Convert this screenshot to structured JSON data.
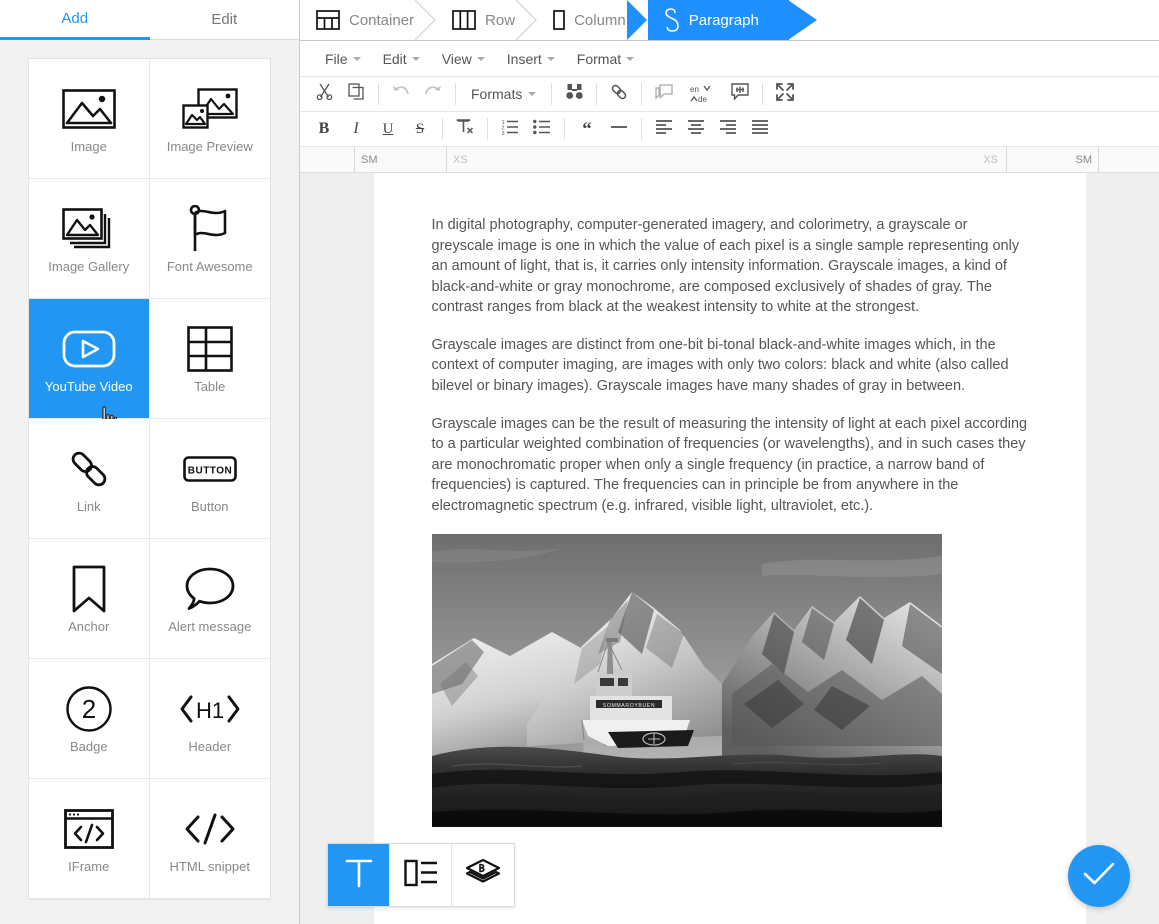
{
  "sidebar": {
    "tabs": [
      {
        "label": "Add",
        "active": true
      },
      {
        "label": "Edit",
        "active": false
      }
    ],
    "items": [
      {
        "label": "Image",
        "icon": "image-icon",
        "active": false
      },
      {
        "label": "Image Preview",
        "icon": "image-preview-icon",
        "active": false
      },
      {
        "label": "Image Gallery",
        "icon": "image-gallery-icon",
        "active": false
      },
      {
        "label": "Font Awesome",
        "icon": "flag-icon",
        "active": false
      },
      {
        "label": "YouTube Video",
        "icon": "youtube-play-icon",
        "active": true
      },
      {
        "label": "Table",
        "icon": "table-icon",
        "active": false
      },
      {
        "label": "Link",
        "icon": "chain-link-icon",
        "active": false
      },
      {
        "label": "Button",
        "icon": "button-icon",
        "active": false
      },
      {
        "label": "Anchor",
        "icon": "bookmark-icon",
        "active": false
      },
      {
        "label": "Alert message",
        "icon": "speech-bubble-icon",
        "active": false
      },
      {
        "label": "Badge",
        "icon": "badge-circle-icon",
        "active": false
      },
      {
        "label": "Header",
        "icon": "h1-tag-icon",
        "active": false
      },
      {
        "label": "IFrame",
        "icon": "iframe-window-icon",
        "active": false
      },
      {
        "label": "HTML snippet",
        "icon": "code-tag-icon",
        "active": false
      }
    ]
  },
  "breadcrumb": [
    {
      "label": "Container",
      "icon": "container-grid-icon",
      "active": false
    },
    {
      "label": "Row",
      "icon": "row-columns-icon",
      "active": false
    },
    {
      "label": "Column",
      "icon": "column-icon",
      "active": false
    },
    {
      "label": "Paragraph",
      "icon": "paragraph-pilcrow-icon",
      "active": true
    }
  ],
  "menubar": [
    {
      "label": "File"
    },
    {
      "label": "Edit"
    },
    {
      "label": "View"
    },
    {
      "label": "Insert"
    },
    {
      "label": "Format"
    }
  ],
  "toolbar_row1": {
    "formats_label": "Formats",
    "buttons": [
      {
        "name": "cut-icon"
      },
      {
        "name": "copy-icon"
      },
      {
        "name": "undo-icon"
      },
      {
        "name": "redo-icon"
      },
      {
        "name": "find-replace-icon"
      },
      {
        "name": "insert-link-icon"
      },
      {
        "name": "comment-icon"
      },
      {
        "name": "translate-icon"
      },
      {
        "name": "annotation-icon"
      },
      {
        "name": "fullscreen-icon"
      }
    ],
    "translate_from": "en",
    "translate_to": "de"
  },
  "toolbar_row2": {
    "buttons": [
      {
        "name": "bold-icon",
        "glyph": "B"
      },
      {
        "name": "italic-icon",
        "glyph": "I"
      },
      {
        "name": "underline-icon",
        "glyph": "U"
      },
      {
        "name": "strikethrough-icon",
        "glyph": "S"
      },
      {
        "name": "clear-formatting-icon",
        "glyph": "Tx"
      },
      {
        "name": "numbered-list-icon"
      },
      {
        "name": "bullet-list-icon"
      },
      {
        "name": "blockquote-icon"
      },
      {
        "name": "horizontal-rule-icon"
      },
      {
        "name": "align-left-icon"
      },
      {
        "name": "align-center-icon"
      },
      {
        "name": "align-right-icon"
      },
      {
        "name": "align-justify-icon"
      }
    ]
  },
  "ruler": {
    "left_sm": "SM",
    "left_xs": "XS",
    "right_xs": "XS",
    "right_sm": "SM"
  },
  "document": {
    "paragraphs": [
      "In digital photography, computer-generated imagery, and colorimetry, a grayscale or greyscale image is one in which the value of each pixel is a single sample representing only an amount of light, that is, it carries only intensity information. Grayscale images, a kind of black-and-white or gray monochrome, are composed exclusively of shades of gray. The contrast ranges from black at the weakest intensity to white at the strongest.",
      "Grayscale images are distinct from one-bit bi-tonal black-and-white images which, in the context of computer imaging, are images with only two colors: black and white (also called bilevel or binary images). Grayscale images have many shades of gray in between.",
      "Grayscale images can be the result of measuring the intensity of light at each pixel according to a particular weighted combination of frequencies (or wavelengths), and in such cases they are monochromatic proper when only a single frequency (in practice, a narrow band of frequencies) is captured. The frequencies can in principle be from anywhere in the electromagnetic spectrum (e.g. infrared, visible light, ultraviolet, etc.)."
    ],
    "image": {
      "name": "grayscale-mountain-boat-photo",
      "boat_name": "SOMMAROYBUEN"
    }
  },
  "bottom_toolbar": [
    {
      "name": "text-tool-button",
      "icon": "text-t-icon",
      "active": true
    },
    {
      "name": "layout-tool-button",
      "icon": "text-layout-icon",
      "active": false
    },
    {
      "name": "layers-tool-button",
      "icon": "layers-stack-icon",
      "active": false
    }
  ],
  "fab": {
    "name": "confirm-button",
    "icon": "checkmark-icon"
  },
  "colors": {
    "accent": "#2196f3",
    "breadcrumb_active": "#1e90ff",
    "canvas_bg": "#efefef",
    "sidebar_bg": "#f2f2f2",
    "text": "#555555",
    "muted": "#888888"
  }
}
